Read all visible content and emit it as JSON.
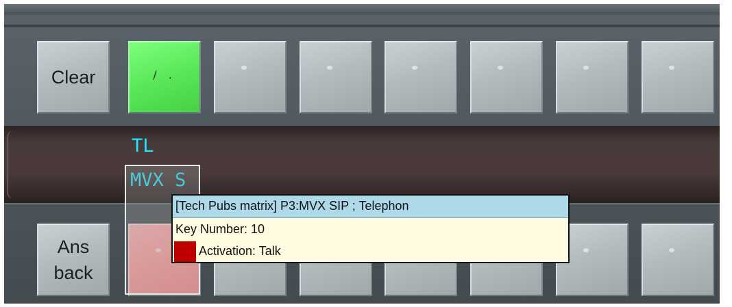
{
  "top_row": {
    "keys": [
      {
        "label": "Clear",
        "state": "normal"
      },
      {
        "label": "∕ .",
        "state": "active-green"
      },
      {
        "label": "",
        "state": "normal"
      },
      {
        "label": "",
        "state": "normal"
      },
      {
        "label": "",
        "state": "normal"
      },
      {
        "label": "",
        "state": "normal"
      },
      {
        "label": "",
        "state": "normal"
      },
      {
        "label": "",
        "state": "normal"
      }
    ]
  },
  "band": {
    "line1": "TL",
    "line2": "MVX S"
  },
  "bottom_row": {
    "keys": [
      {
        "line1": "Ans",
        "line2": "back",
        "state": "normal"
      },
      {
        "label": "",
        "state": "active-pink-selected"
      }
    ]
  },
  "tooltip": {
    "title": "[Tech Pubs matrix] P3:MVX SIP ; Telephon",
    "key_number": "Key Number: 10",
    "activation": "Activation: Talk",
    "activation_color": "#c00000"
  },
  "colors": {
    "green_key": "#5ae85a",
    "pink_key": "#ff9d9d",
    "cyan_text": "#1fe7ff",
    "tooltip_title_bg": "#aed9e9",
    "tooltip_bg": "#fffbe0"
  }
}
